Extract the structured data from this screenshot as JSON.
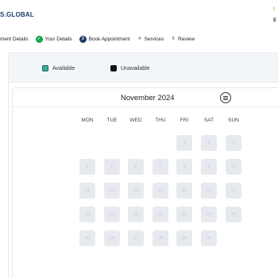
{
  "header": {
    "brand": "S.GLOBAL",
    "mark_top": "I",
    "mark_bottom": "E"
  },
  "stepper": {
    "steps": [
      {
        "label": "ment Details",
        "state": "partial"
      },
      {
        "label": "Your Details",
        "state": "done"
      },
      {
        "number": "3",
        "label": "Book Appointment",
        "state": "active"
      },
      {
        "number": "4",
        "label": "Services",
        "state": "todo"
      },
      {
        "number": "5",
        "label": "Review",
        "state": "todo"
      }
    ]
  },
  "legend": {
    "available": "Available",
    "unavailable": "Unavailable"
  },
  "calendar": {
    "month_title": "November 2024",
    "weekdays": [
      "MON",
      "TUE",
      "WED",
      "THU",
      "FRI",
      "SAT",
      "SUN"
    ],
    "first_weekday_index": 4,
    "days_in_month": 30,
    "all_days_unavailable": true
  },
  "colors": {
    "brand": "#1a3d66",
    "done": "#16a34a",
    "available": "#3fa89a",
    "unavailable": "#111111",
    "day_disabled": "#e6eaee"
  }
}
